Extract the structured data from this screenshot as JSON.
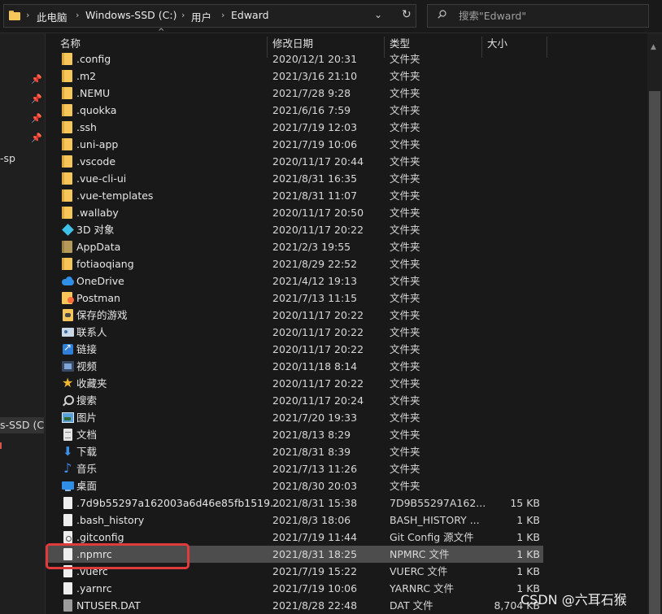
{
  "address": {
    "breadcrumbs": [
      "此电脑",
      "Windows-SSD (C:)",
      "用户",
      "Edward"
    ]
  },
  "search": {
    "placeholder": "搜索\"Edward\""
  },
  "nav": {
    "items": [
      {
        "label": "-sp",
        "selected": false
      },
      {
        "label": "s-SSD (C:)",
        "selected": true
      }
    ]
  },
  "columns": {
    "name": "名称",
    "date": "修改日期",
    "type": "类型",
    "size": "大小"
  },
  "files": [
    {
      "name": ".config",
      "date": "2020/12/1 20:31",
      "type": "文件夹",
      "size": "",
      "icon": "folder-icon"
    },
    {
      "name": ".m2",
      "date": "2021/3/16 21:10",
      "type": "文件夹",
      "size": "",
      "icon": "folder-icon"
    },
    {
      "name": ".NEMU",
      "date": "2021/7/28 9:28",
      "type": "文件夹",
      "size": "",
      "icon": "folder-icon"
    },
    {
      "name": ".quokka",
      "date": "2021/6/16 7:59",
      "type": "文件夹",
      "size": "",
      "icon": "folder-icon"
    },
    {
      "name": ".ssh",
      "date": "2021/7/19 12:03",
      "type": "文件夹",
      "size": "",
      "icon": "folder-icon"
    },
    {
      "name": ".uni-app",
      "date": "2021/7/19 10:06",
      "type": "文件夹",
      "size": "",
      "icon": "folder-icon"
    },
    {
      "name": ".vscode",
      "date": "2020/11/17 20:44",
      "type": "文件夹",
      "size": "",
      "icon": "folder-icon"
    },
    {
      "name": ".vue-cli-ui",
      "date": "2021/8/31 16:35",
      "type": "文件夹",
      "size": "",
      "icon": "folder-icon"
    },
    {
      "name": ".vue-templates",
      "date": "2021/8/31 11:07",
      "type": "文件夹",
      "size": "",
      "icon": "folder-icon"
    },
    {
      "name": ".wallaby",
      "date": "2020/11/17 20:50",
      "type": "文件夹",
      "size": "",
      "icon": "folder-icon"
    },
    {
      "name": "3D 对象",
      "date": "2020/11/17 20:22",
      "type": "文件夹",
      "size": "",
      "icon": "3d-objects-icon"
    },
    {
      "name": "AppData",
      "date": "2021/2/3 19:55",
      "type": "文件夹",
      "size": "",
      "icon": "hidden-folder-icon"
    },
    {
      "name": "fotiaoqiang",
      "date": "2021/8/29 22:52",
      "type": "文件夹",
      "size": "",
      "icon": "folder-icon"
    },
    {
      "name": "OneDrive",
      "date": "2021/4/12 19:13",
      "type": "文件夹",
      "size": "",
      "icon": "onedrive-cloud-icon"
    },
    {
      "name": "Postman",
      "date": "2021/7/13 11:15",
      "type": "文件夹",
      "size": "",
      "icon": "postman-folder-icon"
    },
    {
      "name": "保存的游戏",
      "date": "2020/11/17 20:22",
      "type": "文件夹",
      "size": "",
      "icon": "saved-games-icon"
    },
    {
      "name": "联系人",
      "date": "2020/11/17 20:22",
      "type": "文件夹",
      "size": "",
      "icon": "contacts-icon"
    },
    {
      "name": "链接",
      "date": "2020/11/17 20:22",
      "type": "文件夹",
      "size": "",
      "icon": "links-icon"
    },
    {
      "name": "视频",
      "date": "2020/11/18 8:14",
      "type": "文件夹",
      "size": "",
      "icon": "videos-icon"
    },
    {
      "name": "收藏夹",
      "date": "2020/11/17 20:22",
      "type": "文件夹",
      "size": "",
      "icon": "favorites-star-icon"
    },
    {
      "name": "搜索",
      "date": "2020/11/17 20:24",
      "type": "文件夹",
      "size": "",
      "icon": "searches-icon"
    },
    {
      "name": "图片",
      "date": "2021/7/20 19:33",
      "type": "文件夹",
      "size": "",
      "icon": "pictures-icon"
    },
    {
      "name": "文档",
      "date": "2021/8/13 8:29",
      "type": "文件夹",
      "size": "",
      "icon": "documents-icon"
    },
    {
      "name": "下载",
      "date": "2021/8/31 8:39",
      "type": "文件夹",
      "size": "",
      "icon": "downloads-icon"
    },
    {
      "name": "音乐",
      "date": "2021/7/13 11:26",
      "type": "文件夹",
      "size": "",
      "icon": "music-icon"
    },
    {
      "name": "桌面",
      "date": "2021/8/30 20:03",
      "type": "文件夹",
      "size": "",
      "icon": "desktop-icon"
    },
    {
      "name": ".7d9b55297a162003a6d46e85fb1519...",
      "date": "2021/8/31 15:38",
      "type": "7D9B55297A162...",
      "size": "15 KB",
      "icon": "file-icon"
    },
    {
      "name": ".bash_history",
      "date": "2021/8/3 18:06",
      "type": "BASH_HISTORY ...",
      "size": "1 KB",
      "icon": "file-icon"
    },
    {
      "name": ".gitconfig",
      "date": "2021/7/19 11:44",
      "type": "Git Config 源文件",
      "size": "1 KB",
      "icon": "config-file-icon"
    },
    {
      "name": ".npmrc",
      "date": "2021/8/31 18:25",
      "type": "NPMRC 文件",
      "size": "1 KB",
      "icon": "file-icon",
      "selected": true
    },
    {
      "name": ".vuerc",
      "date": "2021/7/19 15:22",
      "type": "VUERC 文件",
      "size": "1 KB",
      "icon": "file-icon"
    },
    {
      "name": ".yarnrc",
      "date": "2021/7/19 10:06",
      "type": "YARNRC 文件",
      "size": "1 KB",
      "icon": "file-icon"
    },
    {
      "name": "NTUSER.DAT",
      "date": "2021/8/28 22:48",
      "type": "DAT 文件",
      "size": "8,704 KB",
      "icon": "system-file-icon"
    }
  ],
  "watermark": "CSDN @六耳石猴"
}
